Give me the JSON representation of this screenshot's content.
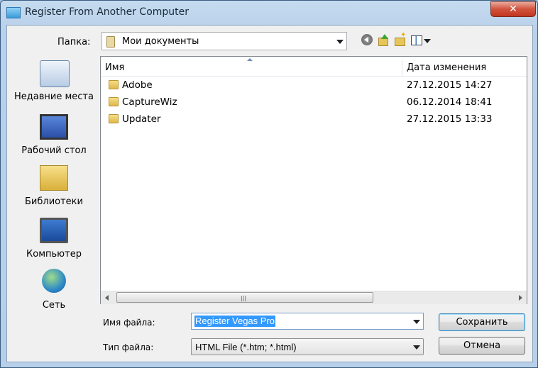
{
  "window": {
    "title": "Register From Another Computer",
    "close_label": "✕"
  },
  "toolbar": {
    "folder_label": "Папка:",
    "folder_value": "Мои документы",
    "icons": [
      "back-icon",
      "up-folder-icon",
      "new-folder-icon",
      "views-menu-icon"
    ]
  },
  "places": [
    {
      "label": "Недавние места",
      "icon": "recent-places-icon"
    },
    {
      "label": "Рабочий стол",
      "icon": "desktop-icon"
    },
    {
      "label": "Библиотеки",
      "icon": "libraries-icon"
    },
    {
      "label": "Компьютер",
      "icon": "computer-icon"
    },
    {
      "label": "Сеть",
      "icon": "network-icon"
    }
  ],
  "filelist": {
    "columns": {
      "name": "Имя",
      "date": "Дата изменения"
    },
    "rows": [
      {
        "name": "Adobe",
        "date": "27.12.2015 14:27"
      },
      {
        "name": "CaptureWiz",
        "date": "06.12.2014 18:41"
      },
      {
        "name": "Updater",
        "date": "27.12.2015 13:33"
      }
    ]
  },
  "form": {
    "filename_label": "Имя файла:",
    "filename_value": "Register Vegas Pro",
    "filetype_label": "Тип файла:",
    "filetype_value": "HTML File (*.htm; *.html)",
    "save_label": "Сохранить",
    "cancel_label": "Отмена"
  },
  "colors": {
    "selection": "#3399ff",
    "titlebar": "#c5dbef",
    "close": "#c0361f"
  }
}
